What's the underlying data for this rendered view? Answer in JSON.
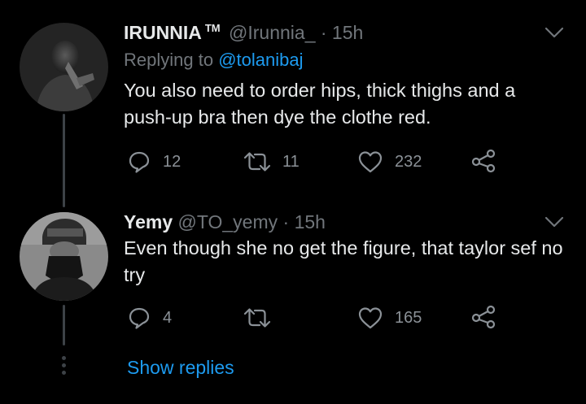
{
  "tweets": [
    {
      "name": "IRUNNIA",
      "badge": "TM",
      "handle": "@Irunnia_",
      "time": "· 15h",
      "replying_prefix": "Replying to",
      "replying_to": "@tolanibaj",
      "text": "You also need to order hips, thick thighs and a push-up bra then dye the clothe red.",
      "replies": "12",
      "retweets": "11",
      "likes": "232"
    },
    {
      "name": "Yemy",
      "handle": "@TO_yemy",
      "time": "· 15h",
      "text": "Even though she no get the figure, that taylor sef no try",
      "replies": "4",
      "retweets": "",
      "likes": "165"
    }
  ],
  "show_replies_label": "Show replies",
  "colors": {
    "background": "#000000",
    "link": "#1d9bf0",
    "muted": "#71767b",
    "thread_line": "#3d4247"
  }
}
